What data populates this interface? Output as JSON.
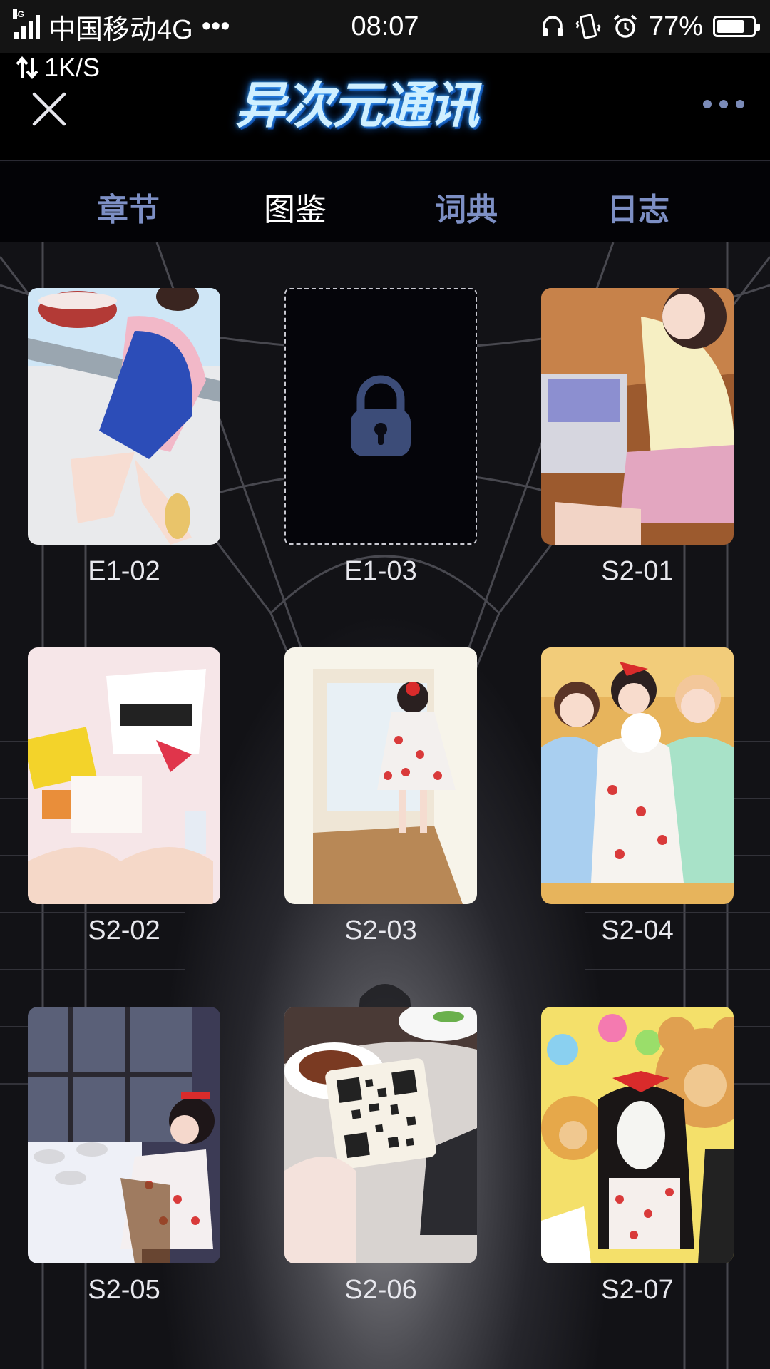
{
  "status_bar": {
    "network_tag": "4G",
    "carrier": "中国移动4G",
    "carrier_dots": "•••",
    "time": "08:07",
    "battery": "77%",
    "battery_level": 0.77,
    "net_speed": "1K/S"
  },
  "header": {
    "logo_text": "异次元通讯",
    "close_icon": "close-icon",
    "more_icon": "more-icon"
  },
  "tabs": [
    {
      "label": "章节",
      "active": false
    },
    {
      "label": "图鉴",
      "active": true
    },
    {
      "label": "词典",
      "active": false
    },
    {
      "label": "日志",
      "active": false
    }
  ],
  "gallery": {
    "items": [
      {
        "code": "E1-02",
        "locked": false
      },
      {
        "code": "E1-03",
        "locked": true
      },
      {
        "code": "S2-01",
        "locked": false
      },
      {
        "code": "S2-02",
        "locked": false
      },
      {
        "code": "S2-03",
        "locked": false
      },
      {
        "code": "S2-04",
        "locked": false
      },
      {
        "code": "S2-05",
        "locked": false
      },
      {
        "code": "S2-06",
        "locked": false
      },
      {
        "code": "S2-07",
        "locked": false
      }
    ]
  },
  "colors": {
    "tab_inactive": "#7d8fc4",
    "tab_active": "#ffffff",
    "lock": "#3c4c78"
  }
}
